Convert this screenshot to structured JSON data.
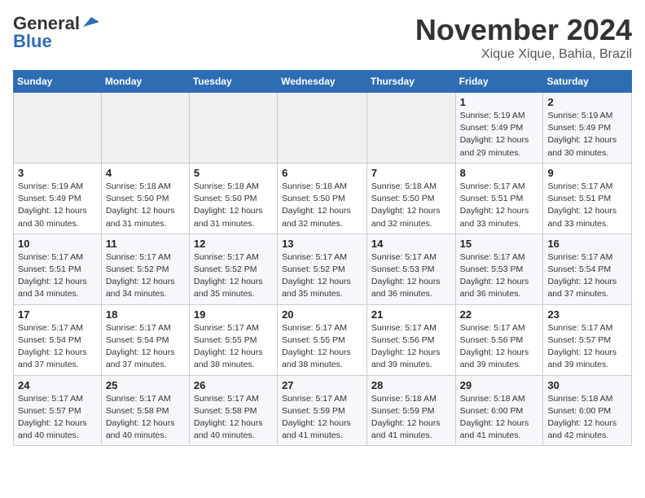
{
  "logo": {
    "part1": "General",
    "part2": "Blue"
  },
  "header": {
    "month": "November 2024",
    "location": "Xique Xique, Bahia, Brazil"
  },
  "weekdays": [
    "Sunday",
    "Monday",
    "Tuesday",
    "Wednesday",
    "Thursday",
    "Friday",
    "Saturday"
  ],
  "weeks": [
    [
      {
        "day": "",
        "info": ""
      },
      {
        "day": "",
        "info": ""
      },
      {
        "day": "",
        "info": ""
      },
      {
        "day": "",
        "info": ""
      },
      {
        "day": "",
        "info": ""
      },
      {
        "day": "1",
        "info": "Sunrise: 5:19 AM\nSunset: 5:49 PM\nDaylight: 12 hours and 29 minutes."
      },
      {
        "day": "2",
        "info": "Sunrise: 5:19 AM\nSunset: 5:49 PM\nDaylight: 12 hours and 30 minutes."
      }
    ],
    [
      {
        "day": "3",
        "info": "Sunrise: 5:19 AM\nSunset: 5:49 PM\nDaylight: 12 hours and 30 minutes."
      },
      {
        "day": "4",
        "info": "Sunrise: 5:18 AM\nSunset: 5:50 PM\nDaylight: 12 hours and 31 minutes."
      },
      {
        "day": "5",
        "info": "Sunrise: 5:18 AM\nSunset: 5:50 PM\nDaylight: 12 hours and 31 minutes."
      },
      {
        "day": "6",
        "info": "Sunrise: 5:18 AM\nSunset: 5:50 PM\nDaylight: 12 hours and 32 minutes."
      },
      {
        "day": "7",
        "info": "Sunrise: 5:18 AM\nSunset: 5:50 PM\nDaylight: 12 hours and 32 minutes."
      },
      {
        "day": "8",
        "info": "Sunrise: 5:17 AM\nSunset: 5:51 PM\nDaylight: 12 hours and 33 minutes."
      },
      {
        "day": "9",
        "info": "Sunrise: 5:17 AM\nSunset: 5:51 PM\nDaylight: 12 hours and 33 minutes."
      }
    ],
    [
      {
        "day": "10",
        "info": "Sunrise: 5:17 AM\nSunset: 5:51 PM\nDaylight: 12 hours and 34 minutes."
      },
      {
        "day": "11",
        "info": "Sunrise: 5:17 AM\nSunset: 5:52 PM\nDaylight: 12 hours and 34 minutes."
      },
      {
        "day": "12",
        "info": "Sunrise: 5:17 AM\nSunset: 5:52 PM\nDaylight: 12 hours and 35 minutes."
      },
      {
        "day": "13",
        "info": "Sunrise: 5:17 AM\nSunset: 5:52 PM\nDaylight: 12 hours and 35 minutes."
      },
      {
        "day": "14",
        "info": "Sunrise: 5:17 AM\nSunset: 5:53 PM\nDaylight: 12 hours and 36 minutes."
      },
      {
        "day": "15",
        "info": "Sunrise: 5:17 AM\nSunset: 5:53 PM\nDaylight: 12 hours and 36 minutes."
      },
      {
        "day": "16",
        "info": "Sunrise: 5:17 AM\nSunset: 5:54 PM\nDaylight: 12 hours and 37 minutes."
      }
    ],
    [
      {
        "day": "17",
        "info": "Sunrise: 5:17 AM\nSunset: 5:54 PM\nDaylight: 12 hours and 37 minutes."
      },
      {
        "day": "18",
        "info": "Sunrise: 5:17 AM\nSunset: 5:54 PM\nDaylight: 12 hours and 37 minutes."
      },
      {
        "day": "19",
        "info": "Sunrise: 5:17 AM\nSunset: 5:55 PM\nDaylight: 12 hours and 38 minutes."
      },
      {
        "day": "20",
        "info": "Sunrise: 5:17 AM\nSunset: 5:55 PM\nDaylight: 12 hours and 38 minutes."
      },
      {
        "day": "21",
        "info": "Sunrise: 5:17 AM\nSunset: 5:56 PM\nDaylight: 12 hours and 39 minutes."
      },
      {
        "day": "22",
        "info": "Sunrise: 5:17 AM\nSunset: 5:56 PM\nDaylight: 12 hours and 39 minutes."
      },
      {
        "day": "23",
        "info": "Sunrise: 5:17 AM\nSunset: 5:57 PM\nDaylight: 12 hours and 39 minutes."
      }
    ],
    [
      {
        "day": "24",
        "info": "Sunrise: 5:17 AM\nSunset: 5:57 PM\nDaylight: 12 hours and 40 minutes."
      },
      {
        "day": "25",
        "info": "Sunrise: 5:17 AM\nSunset: 5:58 PM\nDaylight: 12 hours and 40 minutes."
      },
      {
        "day": "26",
        "info": "Sunrise: 5:17 AM\nSunset: 5:58 PM\nDaylight: 12 hours and 40 minutes."
      },
      {
        "day": "27",
        "info": "Sunrise: 5:17 AM\nSunset: 5:59 PM\nDaylight: 12 hours and 41 minutes."
      },
      {
        "day": "28",
        "info": "Sunrise: 5:18 AM\nSunset: 5:59 PM\nDaylight: 12 hours and 41 minutes."
      },
      {
        "day": "29",
        "info": "Sunrise: 5:18 AM\nSunset: 6:00 PM\nDaylight: 12 hours and 41 minutes."
      },
      {
        "day": "30",
        "info": "Sunrise: 5:18 AM\nSunset: 6:00 PM\nDaylight: 12 hours and 42 minutes."
      }
    ]
  ]
}
